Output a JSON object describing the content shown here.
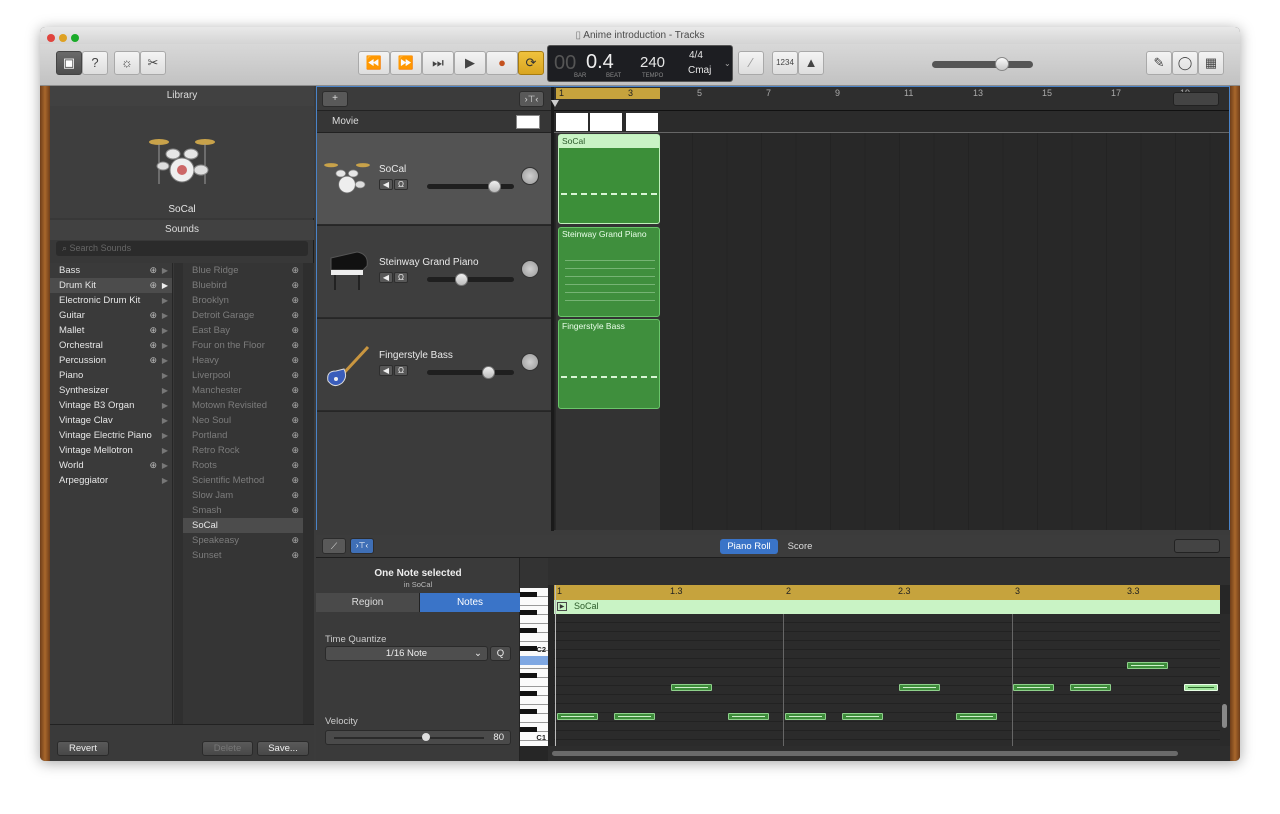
{
  "window": {
    "title": "Anime introduction - Tracks"
  },
  "lcd": {
    "position": "0.4",
    "bar_label": "BAR",
    "beat_label": "BEAT",
    "tempo": "240",
    "tempo_label": "TEMPO",
    "time_sig": "4/4",
    "key": "Cmaj",
    "count_in": "1234"
  },
  "library": {
    "header": "Library",
    "selected_instrument": "SoCal",
    "sounds_header": "Sounds",
    "search_placeholder": "Search Sounds",
    "categories": [
      "Bass",
      "Drum Kit",
      "Electronic Drum Kit",
      "Guitar",
      "Mallet",
      "Orchestral",
      "Percussion",
      "Piano",
      "Synthesizer",
      "Vintage B3 Organ",
      "Vintage Clav",
      "Vintage Electric Piano",
      "Vintage Mellotron",
      "World",
      "Arpeggiator"
    ],
    "sounds": [
      "Blue Ridge",
      "Bluebird",
      "Brooklyn",
      "Detroit Garage",
      "East Bay",
      "Four on the Floor",
      "Heavy",
      "Liverpool",
      "Manchester",
      "Motown Revisited",
      "Neo Soul",
      "Portland",
      "Retro Rock",
      "Roots",
      "Scientific Method",
      "Slow Jam",
      "Smash",
      "SoCal",
      "Speakeasy",
      "Sunset"
    ],
    "revert": "Revert",
    "delete": "Delete",
    "save": "Save..."
  },
  "tracks": {
    "add": "+",
    "movie_label": "Movie",
    "ruler": [
      "1",
      "3",
      "5",
      "7",
      "9",
      "11",
      "13",
      "15",
      "17",
      "19"
    ],
    "items": [
      {
        "name": "SoCal",
        "region": "SoCal",
        "volume": 0.78
      },
      {
        "name": "Steinway Grand Piano",
        "region": "Steinway Grand Piano",
        "volume": 0.4
      },
      {
        "name": "Fingerstyle Bass",
        "region": "Fingerstyle Bass",
        "volume": 0.72
      }
    ]
  },
  "editor": {
    "tab_piano_roll": "Piano Roll",
    "tab_score": "Score",
    "status": "One Note selected",
    "status_sub": "in SoCal",
    "tab_region": "Region",
    "tab_notes": "Notes",
    "time_quantize_label": "Time Quantize",
    "time_quantize_value": "1/16 Note",
    "quantize_button": "Q",
    "velocity_label": "Velocity",
    "velocity_value": "80",
    "ruler": [
      "1",
      "1.3",
      "2",
      "2.3",
      "3",
      "3.3"
    ],
    "region_name": "SoCal",
    "key_c2": "C2",
    "key_c1": "C1"
  }
}
